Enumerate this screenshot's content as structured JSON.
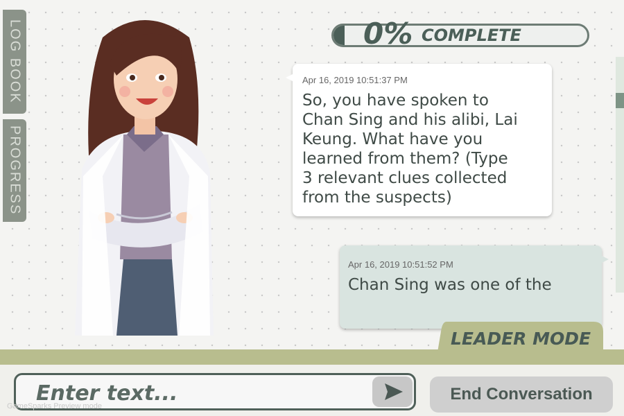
{
  "side_tabs": {
    "log_book": "LOG BOOK",
    "progress": "PROGRESS"
  },
  "progress": {
    "percent_text": "0%",
    "label": "COMPLETE",
    "value": 0
  },
  "messages": [
    {
      "timestamp": "Apr 16, 2019 10:51:37 PM",
      "lines": [
        "So, you have spoken to",
        "Chan Sing and his alibi, Lai",
        "Keung. What have you",
        "learned from them? (Type",
        "3 relevant clues collected",
        "from the suspects)"
      ],
      "sender": "character"
    },
    {
      "timestamp": "Apr 16, 2019 10:51:52 PM",
      "lines": [
        "Chan Sing was one of the"
      ],
      "sender": "player"
    }
  ],
  "mode_tab": {
    "label": "LEADER MODE"
  },
  "input": {
    "placeholder": "Enter text..."
  },
  "buttons": {
    "end_conversation": "End Conversation",
    "send_icon": "send-arrow"
  },
  "watermark": "GameSparks Preview mode",
  "colors": {
    "accent": "#4b5f58",
    "bar": "#b8bd8e",
    "player_bubble": "#d9e4e0"
  }
}
